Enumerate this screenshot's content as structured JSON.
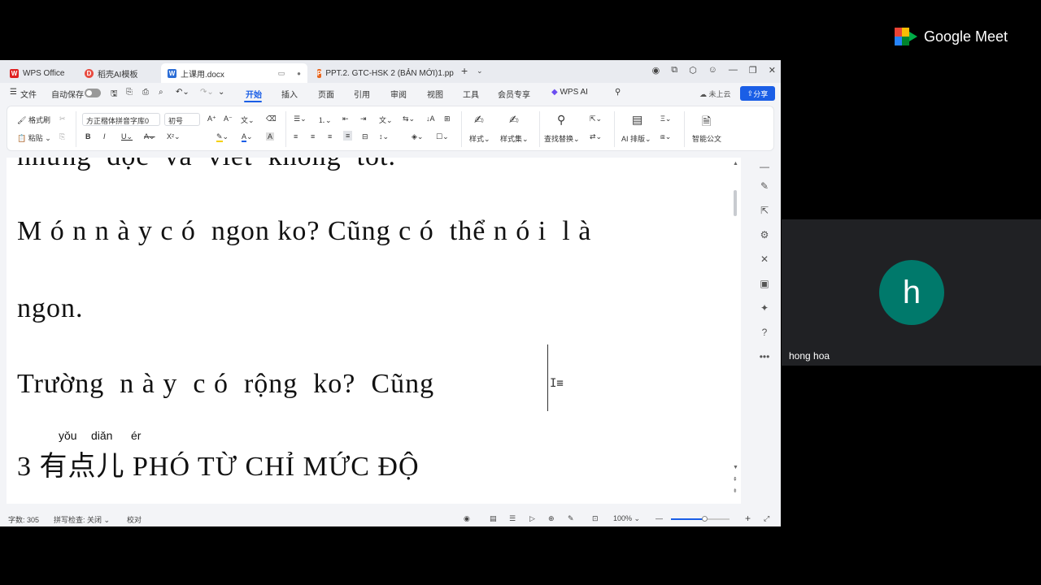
{
  "meet": {
    "brand": "Google Meet",
    "participant": {
      "initial": "h",
      "name": "hong hoa"
    }
  },
  "tabs": [
    {
      "label": "WPS Office",
      "icon": "wps-logo-icon",
      "color": "#e02020"
    },
    {
      "label": "稻壳AI模板",
      "icon": "docer-icon",
      "color": "#e84a3f"
    },
    {
      "label": "上课用.docx",
      "icon": "word-doc-icon",
      "color": "#2b6dd6"
    },
    {
      "label": "PPT.2. GTC-HSK 2 (BẢN MỚI)1.pp",
      "icon": "ppt-icon",
      "color": "#e8661e"
    }
  ],
  "menu": {
    "file": "文件",
    "autosave": "自动保存",
    "items": [
      "开始",
      "插入",
      "页面",
      "引用",
      "审阅",
      "视图",
      "工具",
      "会员专享"
    ],
    "wps_ai": "WPS AI",
    "cloud": "未上云",
    "share": "分享"
  },
  "ribbon": {
    "format_painter": "格式刷",
    "paste": "粘贴",
    "font_name": "方正楷体拼音字库0",
    "font_size": "初号",
    "styles": "样式",
    "style_set": "样式集",
    "find_replace": "查找替换",
    "ai_layout": "AI 排版",
    "smart_doc": "智能公文"
  },
  "document": {
    "line0": "những  đọc  và  viết  không  tốt.",
    "line1": "M ó n n à y c ó  ngon ko? Cũng c ó  thể n ó i  l à",
    "line2": "ngon.",
    "line3": "Trường  n à y  c ó  rộng  ko?  Cũng",
    "line4": "3 有点儿 PHÓ TỪ CHỈ MỨC ĐỘ",
    "pinyin": [
      "yǒu",
      "diǎn",
      "ér"
    ]
  },
  "status": {
    "word_count": "字数: 305",
    "spell_check": "拼写检查: 关闭",
    "proofread": "校对",
    "zoom": "100%"
  },
  "colors": {
    "accent": "#1a5ee6",
    "avatar": "#00796b"
  }
}
